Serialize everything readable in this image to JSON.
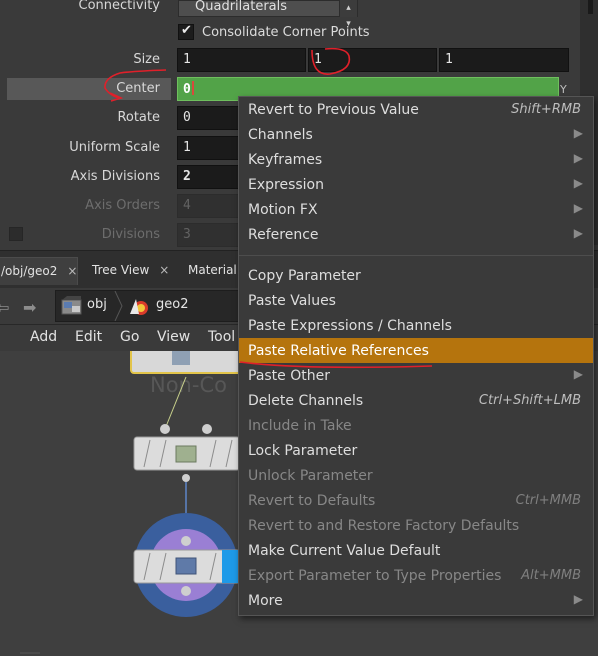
{
  "params": {
    "connectivity": {
      "label": "Connectivity",
      "value": "Quadrilaterals"
    },
    "consolidate": {
      "label": "Consolidate Corner Points",
      "checked": true
    },
    "size": {
      "label": "Size",
      "values": [
        "1",
        "1",
        "1"
      ]
    },
    "center": {
      "label": "Center",
      "value": "0",
      "suffix": "Y"
    },
    "rotate": {
      "label": "Rotate",
      "value": "0"
    },
    "uniform_scale": {
      "label": "Uniform Scale",
      "value": "1"
    },
    "axis_divisions": {
      "label": "Axis Divisions",
      "value": "2"
    },
    "axis_orders": {
      "label": "Axis Orders",
      "value": "4"
    },
    "divisions": {
      "label": "Divisions",
      "value": "3"
    }
  },
  "tabs": [
    {
      "label": "/obj/geo2",
      "close": "×"
    },
    {
      "label": "Tree View",
      "close": "×"
    },
    {
      "label": "Material P"
    }
  ],
  "path": {
    "obj": "obj",
    "geo": "geo2"
  },
  "network_menu": [
    "Add",
    "Edit",
    "Go",
    "View",
    "Tool"
  ],
  "canvas": {
    "watermark": "Non-Co"
  },
  "context_menu": [
    {
      "label": "Revert to Previous Value",
      "shortcut": "Shift+RMB",
      "enabled": true
    },
    {
      "label": "Channels",
      "submenu": true,
      "enabled": true
    },
    {
      "label": "Keyframes",
      "submenu": true,
      "enabled": true
    },
    {
      "label": "Expression",
      "submenu": true,
      "enabled": true
    },
    {
      "label": "Motion FX",
      "submenu": true,
      "enabled": true
    },
    {
      "label": "Reference",
      "submenu": true,
      "enabled": true
    },
    {
      "label": "Copy Parameter",
      "enabled": true
    },
    {
      "label": "Paste Values",
      "enabled": true
    },
    {
      "label": "Paste Expressions / Channels",
      "enabled": true
    },
    {
      "label": "Paste Relative References",
      "enabled": true,
      "highlighted": true
    },
    {
      "label": "Paste Other",
      "submenu": true,
      "enabled": true
    },
    {
      "label": "Delete Channels",
      "shortcut": "Ctrl+Shift+LMB",
      "enabled": true
    },
    {
      "label": "Include in Take",
      "enabled": false
    },
    {
      "label": "Lock Parameter",
      "enabled": true
    },
    {
      "label": "Unlock Parameter",
      "enabled": false
    },
    {
      "label": "Revert to Defaults",
      "shortcut": "Ctrl+MMB",
      "enabled": false
    },
    {
      "label": "Revert to and Restore Factory Defaults",
      "enabled": false
    },
    {
      "label": "Make Current Value Default",
      "enabled": true
    },
    {
      "label": "Export Parameter to Type Properties",
      "shortcut": "Alt+MMB",
      "enabled": false
    },
    {
      "label": "More",
      "submenu": true,
      "enabled": true
    }
  ],
  "colors": {
    "highlight": "#b5740d",
    "center_field": "#52a348",
    "annotation": "#e0202a",
    "node_ring": "#3a5f9e",
    "node_inner": "#9a7fd4"
  }
}
